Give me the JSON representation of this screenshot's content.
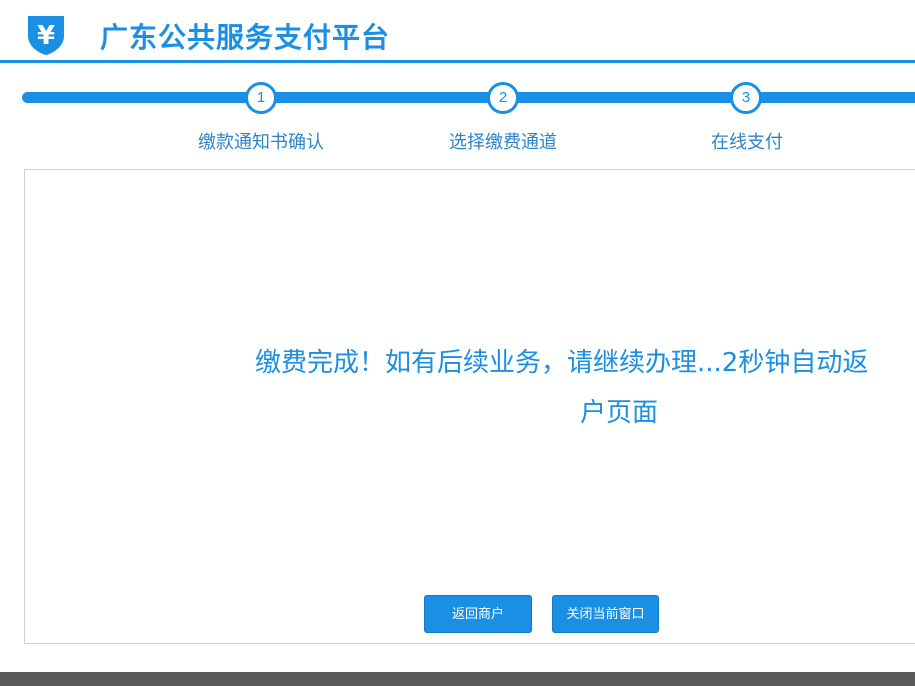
{
  "header": {
    "logo_icon": "yuan-shield-icon",
    "title": "广东公共服务支付平台"
  },
  "steps": [
    {
      "number": "1",
      "label": "缴款通知书确认"
    },
    {
      "number": "2",
      "label": "选择缴费通道"
    },
    {
      "number": "3",
      "label": "在线支付"
    }
  ],
  "main": {
    "message_line1": "缴费完成！如有后续业务，请继续办理...2秒钟自动返",
    "message_line2": "户页面"
  },
  "buttons": {
    "back_label": "返回商户",
    "close_label": "关闭当前窗口"
  },
  "colors": {
    "accent": "#1a8fe3",
    "footer": "#5a5a5a"
  }
}
